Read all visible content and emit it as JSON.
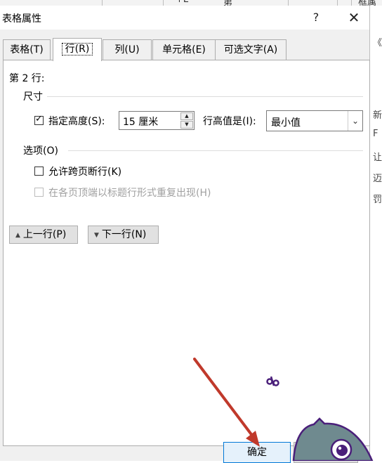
{
  "background": {
    "top_fragments": [
      "+L",
      "第",
      "框属"
    ],
    "right_fragments": [
      "《",
      "新",
      "F",
      "让",
      "迈",
      "罚"
    ]
  },
  "dialog": {
    "title": "表格属性",
    "help_glyph": "?",
    "close_glyph": "✕",
    "tabs": [
      {
        "label": "表格(T)",
        "active": false
      },
      {
        "label": "行(R)",
        "active": true
      },
      {
        "label": "列(U)",
        "active": false
      },
      {
        "label": "单元格(E)",
        "active": false
      },
      {
        "label": "可选文字(A)",
        "active": false
      }
    ],
    "row_label": "第 2 行:",
    "size_group": {
      "title": "尺寸",
      "specify_height_label": "指定高度(S):",
      "specify_height_checked": true,
      "height_value": "15 厘米",
      "row_height_is_label": "行高值是(I):",
      "row_height_is_value": "最小值"
    },
    "options_group": {
      "title": "选项(O)",
      "allow_break_label": "允许跨页断行(K)",
      "allow_break_checked": false,
      "repeat_header_label": "在各页顶端以标题行形式重复出现(H)",
      "repeat_header_checked": false,
      "repeat_header_enabled": false
    },
    "prev_row_label": "上一行(P)",
    "next_row_label": "下一行(N)",
    "ok_label": "确定"
  },
  "colors": {
    "annotation_arrow": "#c0392b",
    "sticker_outline": "#4a1f7a",
    "sticker_fill": "#6f8a8f",
    "ok_border": "#0078d7"
  }
}
